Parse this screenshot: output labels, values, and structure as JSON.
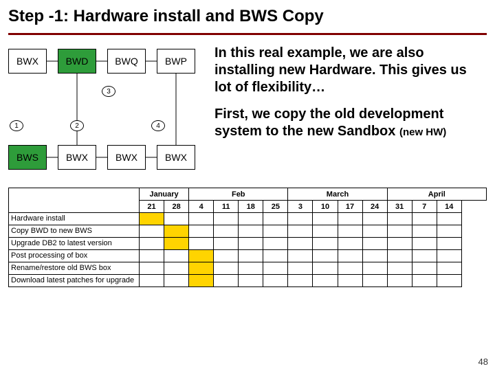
{
  "title": "Step -1: Hardware install and BWS Copy",
  "diagram": {
    "top": [
      "BWX",
      "BWD",
      "BWQ",
      "BWP"
    ],
    "bottom": [
      "BWS",
      "BWX",
      "BWX",
      "BWX"
    ],
    "top_green_idx": [
      1
    ],
    "bottom_green_idx": [
      0
    ],
    "circles": {
      "c1": "1",
      "c2": "2",
      "c3": "3",
      "c4": "4"
    }
  },
  "para1": "In this real example, we are also installing new Hardware. This gives us lot of flexibility…",
  "para2_main": "First, we copy the old development system to the new Sandbox ",
  "para2_sub": "(new HW)",
  "gantt": {
    "months": [
      "January",
      "Feb",
      "March",
      "April"
    ],
    "month_spans": [
      2,
      4,
      4,
      4
    ],
    "weeks": [
      "21",
      "28",
      "4",
      "11",
      "18",
      "25",
      "3",
      "10",
      "17",
      "24",
      "31",
      "7",
      "14"
    ],
    "task_col_header": "",
    "rows": [
      {
        "task": "Hardware install",
        "on": [
          0
        ]
      },
      {
        "task": "Copy BWD to new BWS",
        "on": [
          1
        ]
      },
      {
        "task": "Upgrade DB2 to latest version",
        "on": [
          1
        ]
      },
      {
        "task": "Post processing of box",
        "on": [
          2
        ]
      },
      {
        "task": "Rename/restore old BWS box",
        "on": [
          2
        ]
      },
      {
        "task": "Download latest patches for upgrade",
        "on": [
          2
        ]
      }
    ]
  },
  "pagenum": "48"
}
